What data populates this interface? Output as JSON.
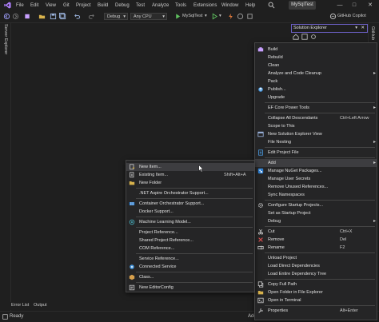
{
  "menubar": {
    "items": [
      "File",
      "Edit",
      "View",
      "Git",
      "Project",
      "Build",
      "Debug",
      "Test",
      "Analyze",
      "Tools",
      "Extensions",
      "Window",
      "Help"
    ],
    "project_name": "MySqlTest"
  },
  "toolbar": {
    "configuration": "Debug",
    "platform": "Any CPU",
    "run_target": "MySqlTest",
    "copilot_label": "GitHub Copilot"
  },
  "left_rail": {
    "server_explorer": "Server Explorer"
  },
  "right_rail": {
    "github_tab": "GitHub"
  },
  "solution_explorer": {
    "title": "Solution Explorer"
  },
  "bottom_tabs": {
    "error_list": "Error List",
    "output": "Output"
  },
  "status_bar": {
    "ready": "Ready",
    "add": "Add"
  },
  "context_menu": {
    "items": [
      {
        "label": "Build",
        "shortcut": "",
        "icon": "build-icon",
        "arrow": false
      },
      {
        "label": "Rebuild",
        "shortcut": "",
        "icon": "",
        "arrow": false
      },
      {
        "label": "Clean",
        "shortcut": "",
        "icon": "",
        "arrow": false
      },
      {
        "label": "Analyze and Code Cleanup",
        "shortcut": "",
        "icon": "",
        "arrow": true
      },
      {
        "label": "Pack",
        "shortcut": "",
        "icon": "",
        "arrow": false
      },
      {
        "label": "Publish...",
        "shortcut": "",
        "icon": "publish-icon",
        "arrow": false
      },
      {
        "label": "Upgrade",
        "shortcut": "",
        "icon": "",
        "arrow": false
      },
      {
        "label": "EF Core Power Tools",
        "shortcut": "",
        "icon": "",
        "arrow": true
      },
      {
        "label": "Collapse All Descendants",
        "shortcut": "Ctrl+Left Arrow",
        "icon": "",
        "arrow": false
      },
      {
        "label": "Scope to This",
        "shortcut": "",
        "icon": "",
        "arrow": false
      },
      {
        "label": "New Solution Explorer View",
        "shortcut": "",
        "icon": "new-view-icon",
        "arrow": false
      },
      {
        "label": "File Nesting",
        "shortcut": "",
        "icon": "",
        "arrow": true
      },
      {
        "label": "Edit Project File",
        "shortcut": "",
        "icon": "edit-project-icon",
        "arrow": false
      },
      {
        "label": "Add",
        "shortcut": "",
        "icon": "",
        "arrow": true
      },
      {
        "label": "Manage NuGet Packages...",
        "shortcut": "",
        "icon": "nuget-icon",
        "arrow": false
      },
      {
        "label": "Manage User Secrets",
        "shortcut": "",
        "icon": "",
        "arrow": false
      },
      {
        "label": "Remove Unused References...",
        "shortcut": "",
        "icon": "",
        "arrow": false
      },
      {
        "label": "Sync Namespaces",
        "shortcut": "",
        "icon": "",
        "arrow": false
      },
      {
        "label": "Configure Startup Projects...",
        "shortcut": "",
        "icon": "gear-icon",
        "arrow": false
      },
      {
        "label": "Set as Startup Project",
        "shortcut": "",
        "icon": "",
        "arrow": false
      },
      {
        "label": "Debug",
        "shortcut": "",
        "icon": "",
        "arrow": true
      },
      {
        "label": "Cut",
        "shortcut": "Ctrl+X",
        "icon": "cut-icon",
        "arrow": false
      },
      {
        "label": "Remove",
        "shortcut": "Del",
        "icon": "close-icon",
        "arrow": false
      },
      {
        "label": "Rename",
        "shortcut": "F2",
        "icon": "rename-icon",
        "arrow": false
      },
      {
        "label": "Unload Project",
        "shortcut": "",
        "icon": "",
        "arrow": false
      },
      {
        "label": "Load Direct Dependencies",
        "shortcut": "",
        "icon": "",
        "arrow": false
      },
      {
        "label": "Load Entire Dependency Tree",
        "shortcut": "",
        "icon": "",
        "arrow": false
      },
      {
        "label": "Copy Full Path",
        "shortcut": "",
        "icon": "copy-icon",
        "arrow": false
      },
      {
        "label": "Open Folder in File Explorer",
        "shortcut": "",
        "icon": "folder-icon",
        "arrow": false
      },
      {
        "label": "Open in Terminal",
        "shortcut": "",
        "icon": "terminal-icon",
        "arrow": false
      },
      {
        "label": "Properties",
        "shortcut": "Alt+Enter",
        "icon": "wrench-icon",
        "arrow": false
      }
    ]
  },
  "add_submenu": {
    "items": [
      {
        "label": "New Item...",
        "shortcut": "",
        "icon": "new-item-icon"
      },
      {
        "label": "Existing Item...",
        "shortcut": "Shift+Alt+A",
        "icon": "existing-item-icon"
      },
      {
        "label": "New Folder",
        "shortcut": "",
        "icon": "folder-icon"
      },
      {
        "label": ".NET Aspire Orchestrator Support...",
        "shortcut": "",
        "icon": ""
      },
      {
        "label": "Container Orchestrator Support...",
        "shortcut": "",
        "icon": "container-icon"
      },
      {
        "label": "Docker Support...",
        "shortcut": "",
        "icon": ""
      },
      {
        "label": "Machine Learning Model...",
        "shortcut": "",
        "icon": "ml-icon"
      },
      {
        "label": "Project Reference...",
        "shortcut": "",
        "icon": ""
      },
      {
        "label": "Shared Project Reference...",
        "shortcut": "",
        "icon": ""
      },
      {
        "label": "COM Reference...",
        "shortcut": "",
        "icon": ""
      },
      {
        "label": "Service Reference...",
        "shortcut": "",
        "icon": ""
      },
      {
        "label": "Connected Service",
        "shortcut": "",
        "icon": "connected-service-icon"
      },
      {
        "label": "Class...",
        "shortcut": "",
        "icon": "class-icon"
      },
      {
        "label": "New EditorConfig",
        "shortcut": "",
        "icon": "editorconfig-icon"
      }
    ]
  },
  "colors": {
    "accent": "#6b5fc4",
    "background": "#1f1f1f",
    "menu_bg": "#252526",
    "highlight": "#3d3d40"
  }
}
